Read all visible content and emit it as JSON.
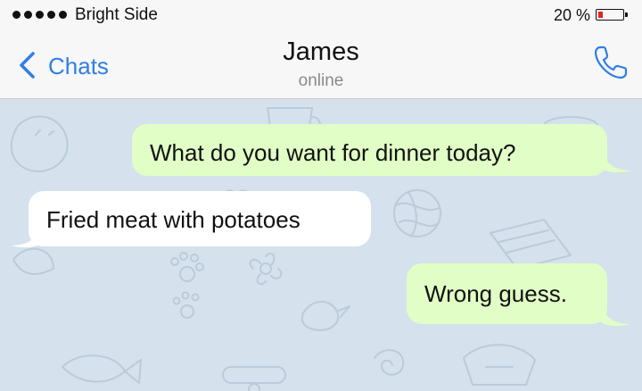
{
  "status_bar": {
    "carrier": "Bright Side",
    "battery_percent": "20 %",
    "battery_level": 0.2,
    "battery_color": "#e3261e"
  },
  "nav": {
    "back_label": "Chats",
    "title": "James",
    "subtitle": "online",
    "back_icon": "chevron-left-icon",
    "call_icon": "phone-icon",
    "accent_color": "#2f7ee6"
  },
  "messages": [
    {
      "direction": "outgoing",
      "text": "What do you want for dinner today?"
    },
    {
      "direction": "incoming",
      "text": "Fried meat with potatoes"
    },
    {
      "direction": "outgoing",
      "text": "Wrong guess."
    }
  ],
  "colors": {
    "outgoing_bubble": "#e1fec6",
    "incoming_bubble": "#ffffff",
    "chat_background": "#d5e1ec"
  }
}
